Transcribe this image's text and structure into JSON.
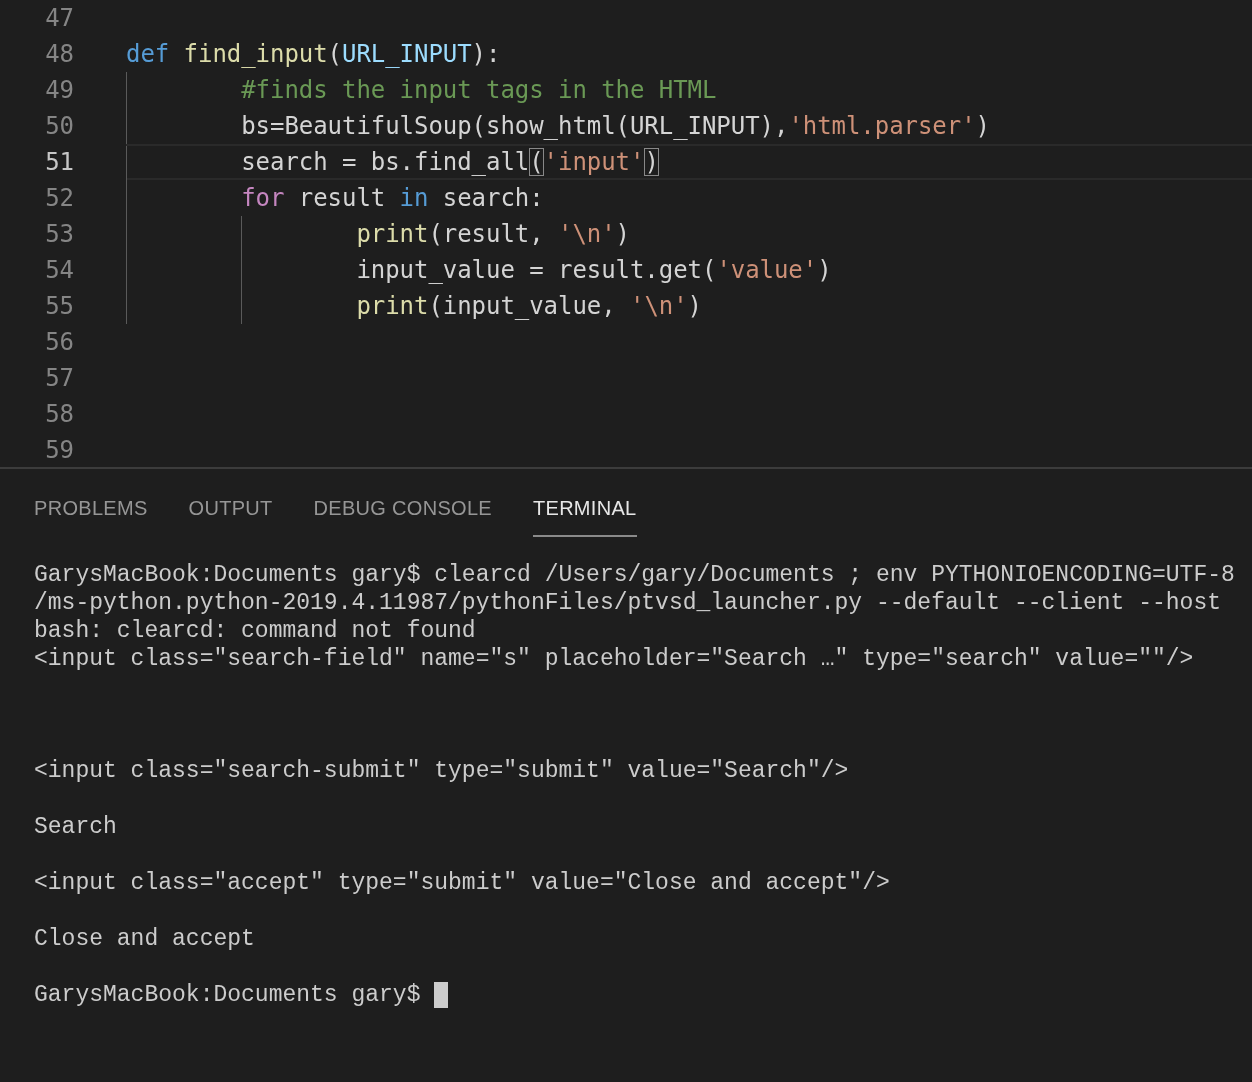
{
  "editor": {
    "lines": [
      {
        "number": "47",
        "current": false
      },
      {
        "number": "48",
        "current": false,
        "tokens": [
          {
            "text": "def",
            "kind": "keyword"
          },
          {
            "text": " find_input",
            "kind": "function"
          },
          {
            "text": "(",
            "kind": "plain"
          },
          {
            "text": "URL_INPUT",
            "kind": "param"
          },
          {
            "text": "):",
            "kind": "plain"
          }
        ]
      },
      {
        "number": "49",
        "current": false,
        "tokens": [
          {
            "text": "        #finds the input tags in the HTML",
            "kind": "comment"
          }
        ]
      },
      {
        "number": "50",
        "current": false,
        "tokens": [
          {
            "text": "        bs=BeautifulSoup(show_html(URL_INPUT),",
            "kind": "plain"
          },
          {
            "text": "'html.parser'",
            "kind": "string"
          },
          {
            "text": ")",
            "kind": "plain"
          }
        ]
      },
      {
        "number": "51",
        "current": true,
        "tokens": [
          {
            "text": "        search = bs.find_all",
            "kind": "plain"
          },
          {
            "text": "(",
            "kind": "plain",
            "matched": true
          },
          {
            "text": "'input'",
            "kind": "string"
          },
          {
            "text": ")",
            "kind": "plain",
            "matched": true
          }
        ]
      },
      {
        "number": "52",
        "current": false,
        "tokens": [
          {
            "text": "        for",
            "kind": "control"
          },
          {
            "text": " result ",
            "kind": "plain"
          },
          {
            "text": "in",
            "kind": "keyword"
          },
          {
            "text": " search:",
            "kind": "plain"
          }
        ]
      },
      {
        "number": "53",
        "current": false,
        "tokens": [
          {
            "text": "                print",
            "kind": "function"
          },
          {
            "text": "(result, ",
            "kind": "plain"
          },
          {
            "text": "'\\n'",
            "kind": "string"
          },
          {
            "text": ")",
            "kind": "plain"
          }
        ]
      },
      {
        "number": "54",
        "current": false,
        "tokens": [
          {
            "text": "                input_value = result.get(",
            "kind": "plain"
          },
          {
            "text": "'value'",
            "kind": "string"
          },
          {
            "text": ")",
            "kind": "plain"
          }
        ]
      },
      {
        "number": "55",
        "current": false,
        "tokens": [
          {
            "text": "                print",
            "kind": "function"
          },
          {
            "text": "(input_value, ",
            "kind": "plain"
          },
          {
            "text": "'\\n'",
            "kind": "string"
          },
          {
            "text": ")",
            "kind": "plain"
          }
        ]
      },
      {
        "number": "56",
        "current": false
      },
      {
        "number": "57",
        "current": false
      },
      {
        "number": "58",
        "current": false
      },
      {
        "number": "59",
        "current": false
      }
    ]
  },
  "panel": {
    "tabs": [
      {
        "label": "PROBLEMS",
        "selected": false
      },
      {
        "label": "OUTPUT",
        "selected": false
      },
      {
        "label": "DEBUG CONSOLE",
        "selected": false
      },
      {
        "label": "TERMINAL",
        "selected": true
      }
    ],
    "terminal": {
      "output": "GarysMacBook:Documents gary$ clearcd /Users/gary/Documents ; env PYTHONIOENCODING=UTF-8\n/ms-python.python-2019.4.11987/pythonFiles/ptvsd_launcher.py --default --client --host\nbash: clearcd: command not found\n<input class=\"search-field\" name=\"s\" placeholder=\"Search …\" type=\"search\" value=\"\"/>\n\n\n\n<input class=\"search-submit\" type=\"submit\" value=\"Search\"/>\n\nSearch\n\n<input class=\"accept\" type=\"submit\" value=\"Close and accept\"/>\n\nClose and accept\n",
      "prompt": "GarysMacBook:Documents gary$"
    }
  }
}
